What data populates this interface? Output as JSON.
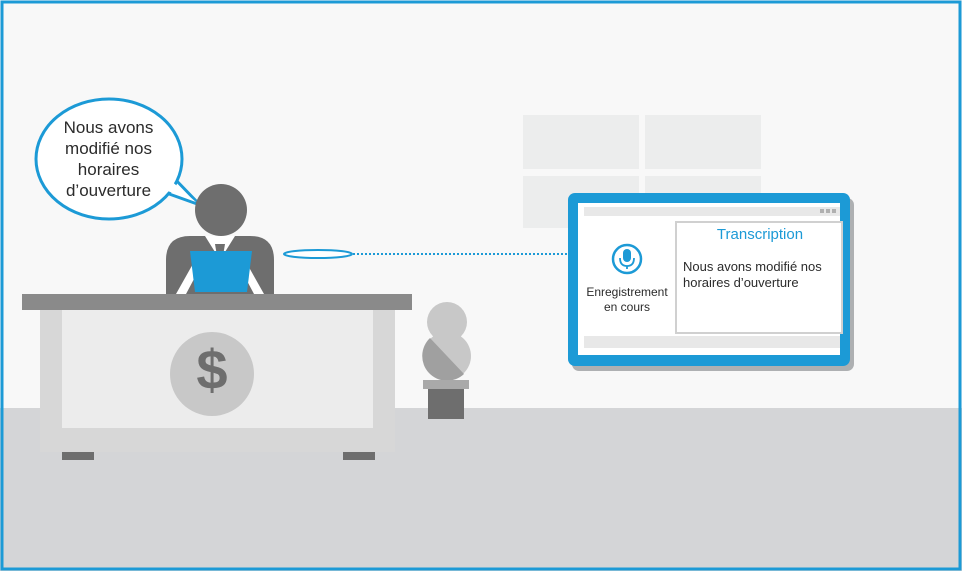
{
  "speech_bubble": {
    "line1": "Nous avons",
    "line2": "modifié nos",
    "line3": "horaires",
    "line4": "d’ouverture"
  },
  "monitor": {
    "status_line1": "Enregistrement",
    "status_line2": "en cours",
    "transcription_title": "Transcription",
    "transcript_line1": "Nous avons modifié nos",
    "transcript_line2": "horaires d’ouverture"
  },
  "desk": {
    "sign_glyph": "$"
  },
  "colors": {
    "frame_border": "#1c9ad6",
    "accent_blue": "#1c9ad6",
    "dark_gray": "#6f6f6f",
    "floor_gray": "#d4d5d7",
    "wall_gray": "#f7f7f7"
  },
  "icons": {
    "microphone": "microphone-icon",
    "window_controls": "window-controls-icon",
    "dollar_sign": "dollar-icon"
  }
}
